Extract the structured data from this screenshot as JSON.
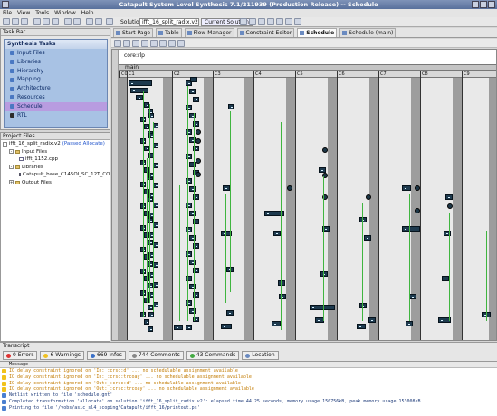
{
  "window": {
    "title": "Catapult System Level Synthesis 7.1/211939 (Production Release) -- Schedule"
  },
  "menu": [
    "File",
    "View",
    "Tools",
    "Window",
    "Help"
  ],
  "toolbar": {
    "solution_label": "Solution:",
    "solution_value": "ifft_16_split_radix.v2 (allocate)",
    "current_solution": "Current Solution"
  },
  "taskbar": {
    "title": "Task Bar",
    "header": "Synthesis Tasks",
    "items": [
      "Input Files",
      "Libraries",
      "Hierarchy",
      "Mapping",
      "Architecture",
      "Resources",
      "Schedule",
      "RTL"
    ],
    "selected": "Schedule"
  },
  "project": {
    "title": "Project Files",
    "solution": "ifft_16_split_radix.v2",
    "status": "(Passed Allocate)",
    "input_files": "Input Files",
    "file": "ifft_1152.cpp",
    "libraries": "Libraries",
    "library": "Catapult_base_C145OI_SC_12T_CORE",
    "output_files": "Output Files"
  },
  "tabs": [
    {
      "label": "Start Page",
      "active": false
    },
    {
      "label": "Table",
      "active": false
    },
    {
      "label": "Flow Manager",
      "active": false
    },
    {
      "label": "Constraint Editor",
      "active": false
    },
    {
      "label": "Schedule",
      "active": true
    },
    {
      "label": "Schedule (main)",
      "active": false
    }
  ],
  "schedule": {
    "core_label": "core:rlp",
    "main_label": "main",
    "csteps": [
      "C0",
      "C1",
      "C2",
      "C3",
      "C4",
      "C5",
      "C6",
      "C7",
      "C8",
      "C9"
    ]
  },
  "transcript": {
    "title": "Transcript",
    "errors": "0 Errors",
    "warnings": "6 Warnings",
    "infos": "669 Infos",
    "comments": "744 Comments",
    "commands": "43 Commands",
    "location": "Location",
    "column": "Message",
    "messages": [
      {
        "type": "w",
        "text": "IO delay constraint ignored on 'In:_:crsc:d' ... no schedulable assignment available"
      },
      {
        "type": "w",
        "text": "IO delay constraint ignored on 'In:_:crsc:trcoay' ... no schedulable assignment available"
      },
      {
        "type": "w",
        "text": "IO delay constraint ignored on 'Out:_:crsc:d' ... no schedulable assignment available"
      },
      {
        "type": "w",
        "text": "IO delay constraint ignored on 'Out:_:crsc:trcoay' ... no schedulable assignment available"
      },
      {
        "type": "i",
        "text": "Netlist written to file 'schedule.gnt'"
      },
      {
        "type": "i",
        "text": "Completed transformation 'allocate' on solution 'ifft_16_split_radix.v2': elapsed time 44.25 seconds, memory usage 150756kB, peak memory usage 153008kB"
      },
      {
        "type": "i",
        "text": "Printing to file '/vobs/asic_sl4_scoping/Catapult/ifft_16/printout.ps'"
      }
    ]
  }
}
